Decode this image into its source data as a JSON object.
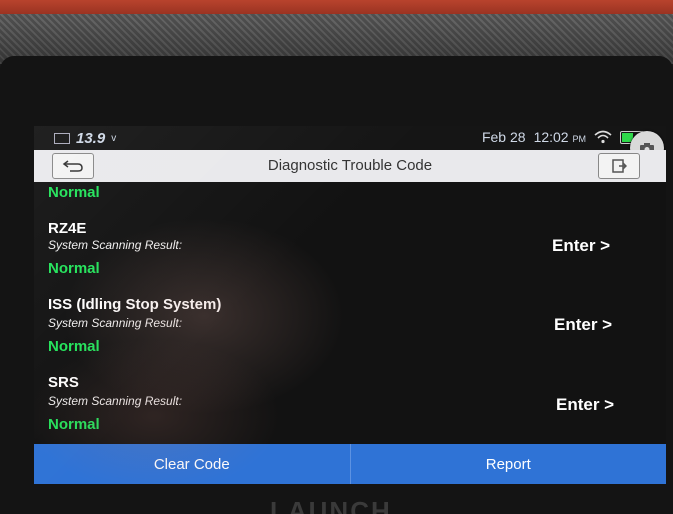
{
  "status": {
    "voltage": "13.9",
    "voltage_unit": "v",
    "date": "Feb 28",
    "time": "12:02",
    "ampm": "PM"
  },
  "header": {
    "title": "Diagnostic Trouble Code"
  },
  "top_partial_status": "Normal",
  "systems": [
    {
      "name": "RZ4E",
      "subtitle": "System Scanning Result:",
      "status": "Normal",
      "action": "Enter >"
    },
    {
      "name": "ISS (Idling Stop System)",
      "subtitle": "System Scanning Result:",
      "status": "Normal",
      "action": "Enter >"
    },
    {
      "name": "SRS",
      "subtitle": "System Scanning Result:",
      "status": "Normal",
      "action": "Enter >"
    }
  ],
  "footer": {
    "clear_label": "Clear Code",
    "report_label": "Report"
  },
  "bezel_brand": "LAUNCH",
  "colors": {
    "status_ok": "#22e35a",
    "action_bar": "#2f73d6",
    "battery": "#2ed84a"
  },
  "icons": [
    "battery-icon",
    "wifi-icon",
    "camera-icon",
    "back-icon",
    "exit-icon"
  ]
}
